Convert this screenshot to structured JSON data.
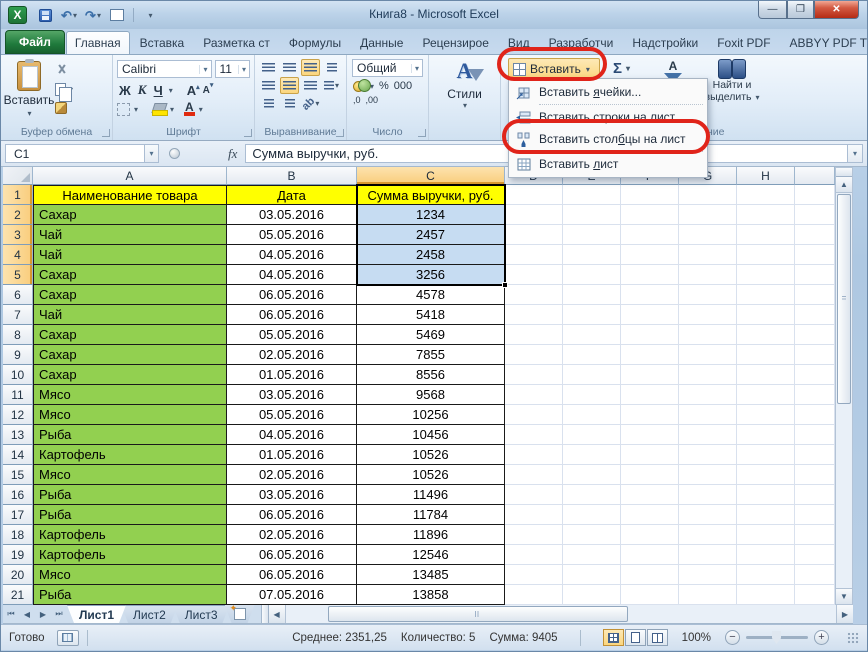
{
  "window": {
    "title": "Книга8 - Microsoft Excel"
  },
  "ribbon_tabs": [
    {
      "label": "Файл",
      "type": "file"
    },
    {
      "label": "Главная",
      "active": true
    },
    {
      "label": "Вставка"
    },
    {
      "label": "Разметка ст"
    },
    {
      "label": "Формулы"
    },
    {
      "label": "Данные"
    },
    {
      "label": "Рецензирое"
    },
    {
      "label": "Вид"
    },
    {
      "label": "Разработчи"
    },
    {
      "label": "Надстройки"
    },
    {
      "label": "Foxit PDF"
    },
    {
      "label": "ABBYY PDF T"
    }
  ],
  "ribbon": {
    "clipboard": {
      "paste_label": "Вставить",
      "group_label": "Буфер обмена"
    },
    "font": {
      "family": "Calibri",
      "size": "11",
      "bold": "Ж",
      "italic": "К",
      "underline": "Ч",
      "grow": "А",
      "shrink": "А",
      "fontcolor": "А",
      "group_label": "Шрифт"
    },
    "alignment": {
      "group_label": "Выравнивание"
    },
    "number": {
      "format": "Общий",
      "percent": "%",
      "thousands": "000",
      "inc_decimal": ",0",
      "dec_decimal": ",00",
      "group_label": "Число"
    },
    "styles": {
      "letter": "А",
      "label": "Стили"
    },
    "cells": {
      "insert_label": "Вставить"
    },
    "editing": {
      "sigma": "Σ",
      "sort_letter": "А",
      "find_line1": "Найти и",
      "find_line2": "выделить",
      "group_label_partial": "ние"
    }
  },
  "formula_bar": {
    "name_box": "C1",
    "fx_label": "fx",
    "value": "Сумма выручки, руб."
  },
  "insert_menu": {
    "items": [
      {
        "pre": "Вставить ",
        "key": "я",
        "post": "чейки...",
        "icon": "insert-cells-icon",
        "circled": false
      },
      {
        "pre": "Вставить ",
        "key": "с",
        "post": "троки на лист",
        "icon": "insert-rows-icon",
        "circled": false
      },
      {
        "pre": "Вставить стол",
        "key": "б",
        "post": "цы на лист",
        "icon": "insert-columns-icon",
        "circled": true
      },
      {
        "pre": "Вставить ",
        "key": "л",
        "post": "ист",
        "icon": "insert-sheet-icon",
        "circled": false
      }
    ]
  },
  "grid": {
    "column_headers": [
      "A",
      "B",
      "C",
      "D",
      "E",
      "F",
      "G",
      "H",
      ""
    ],
    "selected_range": "C1:C5",
    "rows": [
      {
        "n": "1",
        "a": "Наименование товара",
        "b": "Дата",
        "c": "Сумма выручки, руб."
      },
      {
        "n": "2",
        "a": "Сахар",
        "b": "03.05.2016",
        "c": "1234"
      },
      {
        "n": "3",
        "a": "Чай",
        "b": "05.05.2016",
        "c": "2457"
      },
      {
        "n": "4",
        "a": "Чай",
        "b": "04.05.2016",
        "c": "2458"
      },
      {
        "n": "5",
        "a": "Сахар",
        "b": "04.05.2016",
        "c": "3256"
      },
      {
        "n": "6",
        "a": "Сахар",
        "b": "06.05.2016",
        "c": "4578"
      },
      {
        "n": "7",
        "a": "Чай",
        "b": "06.05.2016",
        "c": "5418"
      },
      {
        "n": "8",
        "a": "Сахар",
        "b": "05.05.2016",
        "c": "5469"
      },
      {
        "n": "9",
        "a": "Сахар",
        "b": "02.05.2016",
        "c": "7855"
      },
      {
        "n": "10",
        "a": "Сахар",
        "b": "01.05.2016",
        "c": "8556"
      },
      {
        "n": "11",
        "a": "Мясо",
        "b": "03.05.2016",
        "c": "9568"
      },
      {
        "n": "12",
        "a": "Мясо",
        "b": "05.05.2016",
        "c": "10256"
      },
      {
        "n": "13",
        "a": "Рыба",
        "b": "04.05.2016",
        "c": "10456"
      },
      {
        "n": "14",
        "a": "Картофель",
        "b": "01.05.2016",
        "c": "10526"
      },
      {
        "n": "15",
        "a": "Мясо",
        "b": "02.05.2016",
        "c": "10526"
      },
      {
        "n": "16",
        "a": "Рыба",
        "b": "03.05.2016",
        "c": "11496"
      },
      {
        "n": "17",
        "a": "Рыба",
        "b": "06.05.2016",
        "c": "11784"
      },
      {
        "n": "18",
        "a": "Картофель",
        "b": "02.05.2016",
        "c": "11896"
      },
      {
        "n": "19",
        "a": "Картофель",
        "b": "06.05.2016",
        "c": "12546"
      },
      {
        "n": "20",
        "a": "Мясо",
        "b": "06.05.2016",
        "c": "13485"
      },
      {
        "n": "21",
        "a": "Рыба",
        "b": "07.05.2016",
        "c": "13858"
      }
    ]
  },
  "sheet_tabs": {
    "tabs": [
      {
        "label": "Лист1",
        "active": true
      },
      {
        "label": "Лист2",
        "active": false
      },
      {
        "label": "Лист3",
        "active": false
      }
    ]
  },
  "status_bar": {
    "mode": "Готово",
    "average_label": "Среднее:",
    "average_value": "2351,25",
    "count_label": "Количество:",
    "count_value": "5",
    "sum_label": "Сумма:",
    "sum_value": "9405",
    "zoom": "100%"
  },
  "colors": {
    "accent_red": "#e0241a",
    "fill_green": "#92d050",
    "header_yellow": "#ffff00",
    "selection_blue": "#c6dcf2"
  }
}
